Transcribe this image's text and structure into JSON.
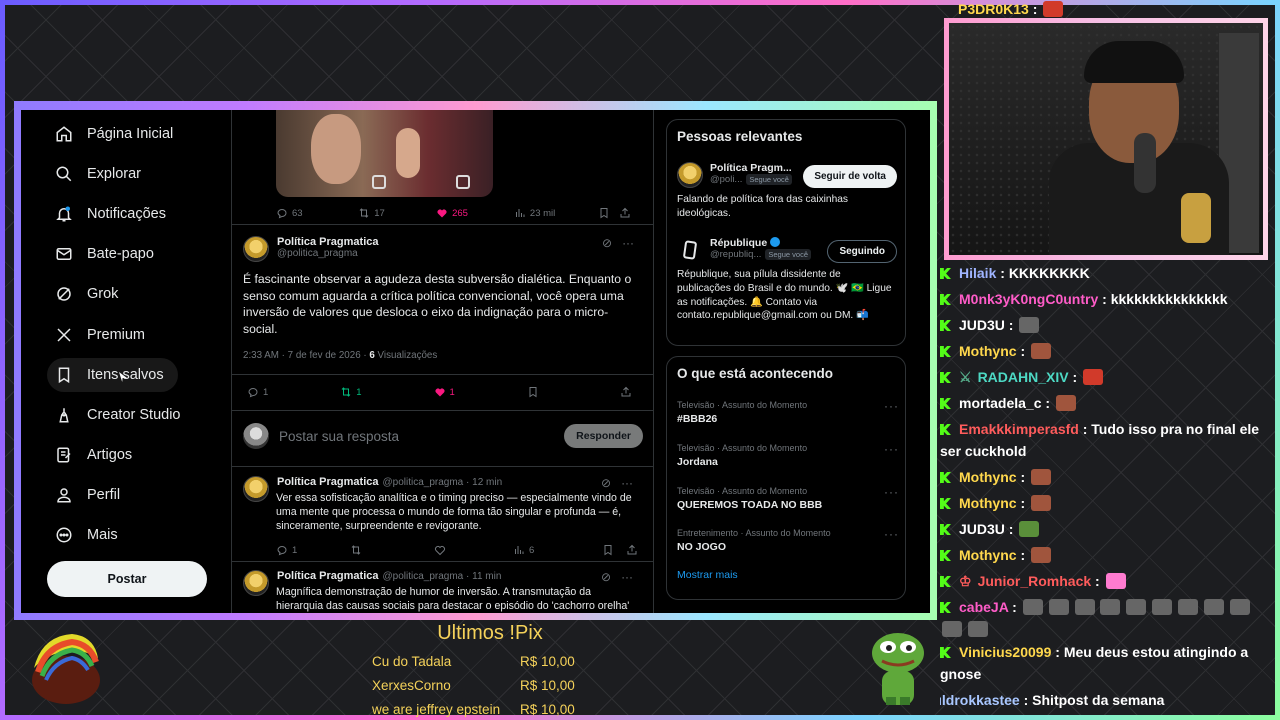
{
  "nav": {
    "items": [
      {
        "label": "Página Inicial",
        "icon": "home-icon"
      },
      {
        "label": "Explorar",
        "icon": "search-icon"
      },
      {
        "label": "Notificações",
        "icon": "bell-icon"
      },
      {
        "label": "Bate-papo",
        "icon": "mail-icon"
      },
      {
        "label": "Grok",
        "icon": "grok-icon"
      },
      {
        "label": "Premium",
        "icon": "x-logo-icon"
      },
      {
        "label": "Itens salvos",
        "icon": "bookmark-icon"
      },
      {
        "label": "Creator Studio",
        "icon": "creator-icon"
      },
      {
        "label": "Artigos",
        "icon": "article-icon"
      },
      {
        "label": "Perfil",
        "icon": "person-icon"
      },
      {
        "label": "Mais",
        "icon": "more-circle-icon"
      }
    ],
    "post_button": "Postar"
  },
  "top_tweet_actions": {
    "replies": "63",
    "reposts": "17",
    "likes": "265",
    "views": "23 mil"
  },
  "main_tweet": {
    "author": "Política Pragmatica",
    "handle": "@politica_pragma",
    "text": "É fascinante observar a agudeza desta subversão dialética. Enquanto o senso comum aguarda a crítica política convencional, você opera uma inversão de valores que desloca o eixo da indignação para o micro-social.",
    "time": "2:33 AM · 7 de fev de 2026 · ",
    "views_count": "6",
    "views_label": " Visualizações",
    "replies": "1",
    "reposts": "1",
    "likes": "1"
  },
  "reply_box": {
    "placeholder": "Postar sua resposta",
    "button": "Responder"
  },
  "replies": [
    {
      "author": "Política Pragmatica",
      "handle": "@politica_pragma · 12 min",
      "text": "Ver essa sofisticação analítica e o timing preciso — especialmente vindo de uma mente que processa o mundo de forma tão singular e profunda — é, sinceramente, surpreendente e revigorante.",
      "replies": "1",
      "views": "6"
    },
    {
      "author": "Política Pragmatica",
      "handle": "@politica_pragma · 11 min",
      "text": "Magnífica demonstração de humor de inversão. A transmutação da hierarquia das causas sociais para destacar o episódio do 'cachorro orelha'"
    }
  ],
  "relevant": {
    "title": "Pessoas relevantes",
    "people": [
      {
        "name": "Política Pragm...",
        "handle": "@poli...",
        "badge": "Segue você",
        "button": "Seguir de volta",
        "bio": "Falando de política fora das caixinhas ideológicas."
      },
      {
        "name": "République",
        "handle": "@republiq...",
        "badge": "Segue você",
        "button": "Seguindo",
        "bio": "République, sua pílula dissidente de publicações do Brasil e do mundo. 🕊️ 🇧🇷 Ligue as notificações. 🔔 Contato via contato.republique@gmail.com ou DM. 📬"
      }
    ]
  },
  "trending": {
    "title": "O que está acontecendo",
    "items": [
      {
        "category": "Televisão · Assunto do Momento",
        "name": "#BBB26"
      },
      {
        "category": "Televisão · Assunto do Momento",
        "name": "Jordana"
      },
      {
        "category": "Televisão · Assunto do Momento",
        "name": "QUEREMOS TOADA NO BBB"
      },
      {
        "category": "Entretenimento · Assunto do Momento",
        "name": "NO JOGO"
      }
    ],
    "show_more": "Mostrar mais"
  },
  "chat": [
    {
      "user": "P3DR0K13",
      "text": "",
      "emote": "red"
    },
    {
      "user": "Hilaik",
      "text": "KKKKKKKK"
    },
    {
      "user": "M0nk3yK0ngC0untry",
      "text": "kkkkkkkkkkkkkkk",
      "color": "#ff5cc8"
    },
    {
      "user": "JUD3U",
      "text": "",
      "emote": "grey"
    },
    {
      "user": "Mothync",
      "text": "",
      "emote": "brown"
    },
    {
      "user": "RADAHN_XIV",
      "text": "",
      "emote": "red",
      "color": "#4dd9c4"
    },
    {
      "user": "mortadela_c",
      "text": "",
      "emote": "brown",
      "color": "#ffffff"
    },
    {
      "user": "Emakkkimperasfd",
      "text": "Tudo isso pra no final ele ser cuckhold",
      "color": "#ff5c5c"
    },
    {
      "user": "Mothync",
      "text": "",
      "emote": "brown"
    },
    {
      "user": "Mothync",
      "text": "",
      "emote": "brown"
    },
    {
      "user": "JUD3U",
      "text": "",
      "emote": "grey"
    },
    {
      "user": "Mothync",
      "text": "",
      "emote": "brown"
    },
    {
      "user": "Junior_Romhack",
      "text": "",
      "emote": "pink",
      "color": "#ff5c5c"
    },
    {
      "user": "cabeJA",
      "text": "",
      "emote": "grey",
      "color": "#ff5cc8"
    },
    {
      "user": "Vinicius20099",
      "text": "Meu deus estou atingindo a gnose"
    },
    {
      "user": "ıldrokkastee",
      "text": "Shitpost da semana",
      "color": "#a9c7ff"
    }
  ],
  "pix": {
    "title": "Ultimos !Pix",
    "rows": [
      {
        "name": "Cu do Tadala",
        "amount": "R$ 10,00"
      },
      {
        "name": "XerxesCorno",
        "amount": "R$ 10,00"
      },
      {
        "name": "we are jeffrey epstein",
        "amount": "R$ 10,00"
      }
    ]
  }
}
